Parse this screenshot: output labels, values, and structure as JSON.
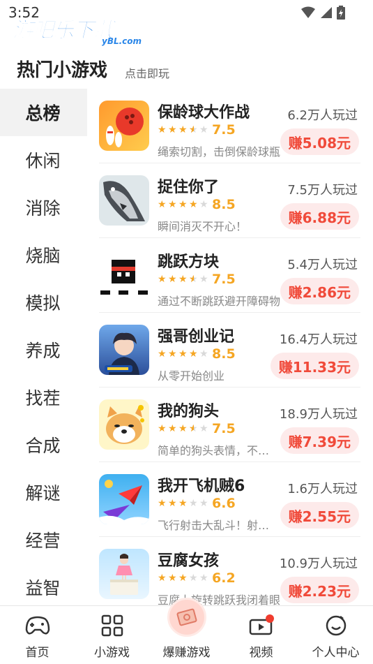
{
  "status_bar": {
    "time": "3:52"
  },
  "watermark": {
    "title": "游吧乐下载",
    "sub": "yBL.com"
  },
  "header": {
    "title": "热门小游戏",
    "subtitle": "点击即玩"
  },
  "sidebar": {
    "items": [
      {
        "label": "总榜",
        "active": true
      },
      {
        "label": "休闲"
      },
      {
        "label": "消除"
      },
      {
        "label": "烧脑"
      },
      {
        "label": "模拟"
      },
      {
        "label": "养成"
      },
      {
        "label": "找茬"
      },
      {
        "label": "合成"
      },
      {
        "label": "解谜"
      },
      {
        "label": "经营"
      },
      {
        "label": "益智"
      }
    ]
  },
  "games": [
    {
      "name": "保龄球大作战",
      "rating": 3.5,
      "score": "7.5",
      "desc": "绳索切割，击倒保龄球瓶",
      "players": "6.2万人玩过",
      "earn": "赚5.08元",
      "icon": "bowling-icon"
    },
    {
      "name": "捉住你了",
      "rating": 4,
      "score": "8.5",
      "desc": "瞬间消灭不开心！",
      "players": "7.5万人玩过",
      "earn": "赚6.88元",
      "icon": "fish-icon"
    },
    {
      "name": "跳跃方块",
      "rating": 3.5,
      "score": "7.5",
      "desc": "通过不断跳跃避开障碍物",
      "players": "5.4万人玩过",
      "earn": "赚2.86元",
      "icon": "ninja-block-icon"
    },
    {
      "name": "强哥创业记",
      "rating": 4,
      "score": "8.5",
      "desc": "从零开始创业",
      "players": "16.4万人玩过",
      "earn": "赚11.33元",
      "icon": "character-icon"
    },
    {
      "name": "我的狗头",
      "rating": 3.5,
      "score": "7.5",
      "desc": "简单的狗头表情，不一样的",
      "players": "18.9万人玩过",
      "earn": "赚7.39元",
      "icon": "dog-head-icon"
    },
    {
      "name": "我开飞机贼6",
      "rating": 3,
      "score": "6.6",
      "desc": "飞行射击大乱斗！射击闯关",
      "players": "1.6万人玩过",
      "earn": "赚2.55元",
      "icon": "paper-plane-icon"
    },
    {
      "name": "豆腐女孩",
      "rating": 3,
      "score": "6.2",
      "desc": "豆腐上旋转跳跃我闭着眼",
      "players": "10.9万人玩过",
      "earn": "赚2.23元",
      "icon": "tofu-girl-icon"
    }
  ],
  "bottom_nav": {
    "items": [
      {
        "label": "首页",
        "icon": "gamepad-icon"
      },
      {
        "label": "小游戏",
        "icon": "grid-icon"
      },
      {
        "label": "爆赚游戏",
        "icon": "money-icon"
      },
      {
        "label": "视频",
        "icon": "video-icon"
      },
      {
        "label": "个人中心",
        "icon": "profile-icon"
      }
    ]
  },
  "colors": {
    "accent_red": "#f04a3a",
    "star": "#f5a623",
    "brand_blue": "#2a86e8"
  }
}
